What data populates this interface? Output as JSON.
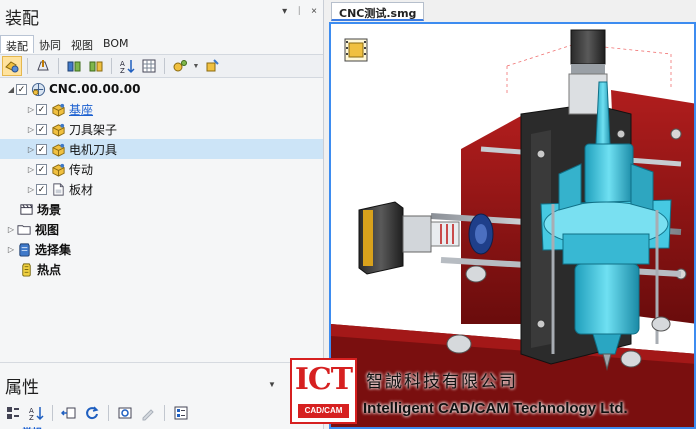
{
  "assembly_panel": {
    "title": "装配",
    "controls": [
      "▾",
      "ᛁ",
      "×"
    ],
    "tabs": [
      "装配",
      "协同",
      "视图",
      "BOM"
    ],
    "toolbar_icons": [
      "assembly-icon",
      "insert-part-icon",
      "constraint-icon",
      "sort-icon",
      "table-icon",
      "options-icon",
      "settings-icon"
    ]
  },
  "tree": {
    "root": {
      "label": "CNC.00.00.00",
      "checked": true
    },
    "children": [
      {
        "label": "基座",
        "checked": true,
        "link": true
      },
      {
        "label": "刀具架子",
        "checked": true
      },
      {
        "label": "电机刀具",
        "checked": true,
        "selected": true
      },
      {
        "label": "传动",
        "checked": true
      },
      {
        "label": "板材",
        "checked": true
      }
    ],
    "top_nodes": [
      {
        "label": "场景",
        "icon": "scene-icon"
      },
      {
        "label": "视图",
        "icon": "folder-icon"
      },
      {
        "label": "选择集",
        "icon": "selection-set-icon"
      },
      {
        "label": "热点",
        "icon": "hotspot-icon"
      }
    ]
  },
  "properties_panel": {
    "title": "属性",
    "control": "▼",
    "cut_label": "常规"
  },
  "document": {
    "tab_label": "CNC测试.smg"
  },
  "watermark": {
    "brand": "ICT",
    "brand_sub": "CAD/CAM",
    "company_cn": "智誠科技有限公司",
    "company_en": "Intelligent CAD/CAM Technology Ltd."
  },
  "colors": {
    "accent": "#3d8cf0",
    "selection": "#cce4f7",
    "brand_red": "#d62020",
    "frame_red": "#8c1414",
    "spindle_cyan": "#38c6e0"
  }
}
